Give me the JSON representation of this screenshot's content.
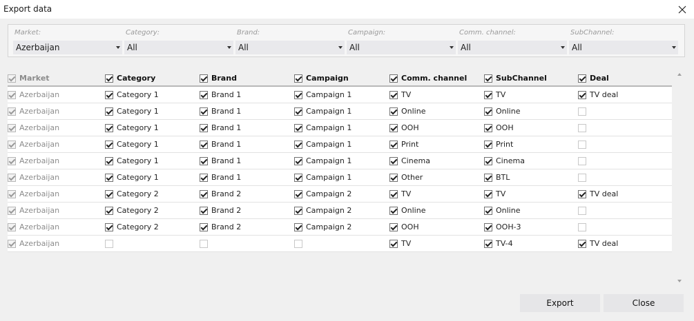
{
  "window": {
    "title": "Export data",
    "close_icon": "close-icon"
  },
  "filters": [
    {
      "label": "Market:",
      "value": "Azerbaijan"
    },
    {
      "label": "Category:",
      "value": "All"
    },
    {
      "label": "Brand:",
      "value": "All"
    },
    {
      "label": "Campaign:",
      "value": "All"
    },
    {
      "label": "Comm. channel:",
      "value": "All"
    },
    {
      "label": "SubChannel:",
      "value": "All"
    }
  ],
  "columns": [
    {
      "label": "Market",
      "checked": true,
      "disabled": true
    },
    {
      "label": "Category",
      "checked": true,
      "disabled": false
    },
    {
      "label": "Brand",
      "checked": true,
      "disabled": false
    },
    {
      "label": "Campaign",
      "checked": true,
      "disabled": false
    },
    {
      "label": "Comm. channel",
      "checked": true,
      "disabled": false
    },
    {
      "label": "SubChannel",
      "checked": true,
      "disabled": false
    },
    {
      "label": "Deal",
      "checked": true,
      "disabled": false
    }
  ],
  "rows": [
    [
      "Azerbaijan",
      "Category 1",
      "Brand 1",
      "Campaign 1",
      "TV",
      "TV",
      "TV deal"
    ],
    [
      "Azerbaijan",
      "Category 1",
      "Brand 1",
      "Campaign 1",
      "Online",
      "Online",
      ""
    ],
    [
      "Azerbaijan",
      "Category 1",
      "Brand 1",
      "Campaign 1",
      "OOH",
      "OOH",
      ""
    ],
    [
      "Azerbaijan",
      "Category 1",
      "Brand 1",
      "Campaign 1",
      "Print",
      "Print",
      ""
    ],
    [
      "Azerbaijan",
      "Category 1",
      "Brand 1",
      "Campaign 1",
      "Cinema",
      "Cinema",
      ""
    ],
    [
      "Azerbaijan",
      "Category 1",
      "Brand 1",
      "Campaign 1",
      "Other",
      "BTL",
      ""
    ],
    [
      "Azerbaijan",
      "Category 2",
      "Brand 2",
      "Campaign 2",
      "TV",
      "TV",
      "TV deal"
    ],
    [
      "Azerbaijan",
      "Category 2",
      "Brand 2",
      "Campaign 2",
      "Online",
      "Online",
      ""
    ],
    [
      "Azerbaijan",
      "Category 2",
      "Brand 2",
      "Campaign 2",
      "OOH",
      "OOH-3",
      ""
    ],
    [
      "Azerbaijan",
      "",
      "",
      "",
      "TV",
      "TV-4",
      "TV deal"
    ]
  ],
  "buttons": {
    "export": "Export",
    "close": "Close"
  },
  "colors": {
    "background": "#f0f0f0",
    "button": "#e6e6e8",
    "row": "#ffffff"
  }
}
